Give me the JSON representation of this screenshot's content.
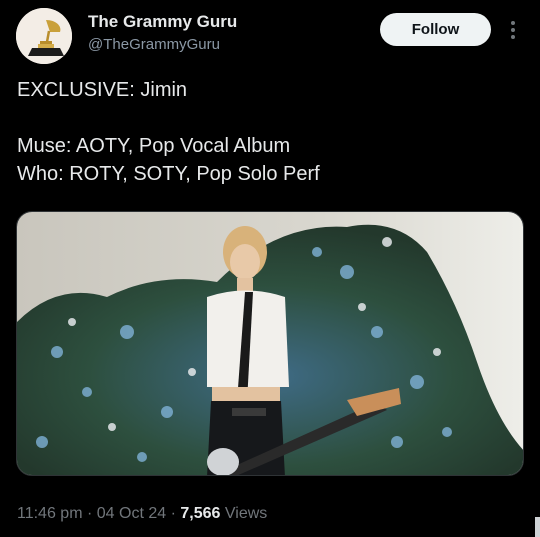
{
  "author": {
    "display_name": "The Grammy Guru",
    "handle": "@TheGrammyGuru",
    "avatar_icon": "grammy-gramophone-icon"
  },
  "actions": {
    "follow_label": "Follow",
    "more_icon": "more-vertical-icon"
  },
  "tweet": {
    "lines": [
      "EXCLUSIVE: Jimin",
      "",
      "Muse: AOTY, Pop Vocal Album",
      "Who: ROTY, SOTY, Pop Solo Perf"
    ]
  },
  "media": {
    "kind": "photo"
  },
  "meta": {
    "time": "11:46 pm",
    "date": "04 Oct 24",
    "separator": "·",
    "views_count": "7,566",
    "views_label": "Views"
  },
  "colors": {
    "background": "#000000",
    "text_primary": "#e7e9ea",
    "text_secondary": "#71767b",
    "follow_bg": "#eff3f4"
  }
}
